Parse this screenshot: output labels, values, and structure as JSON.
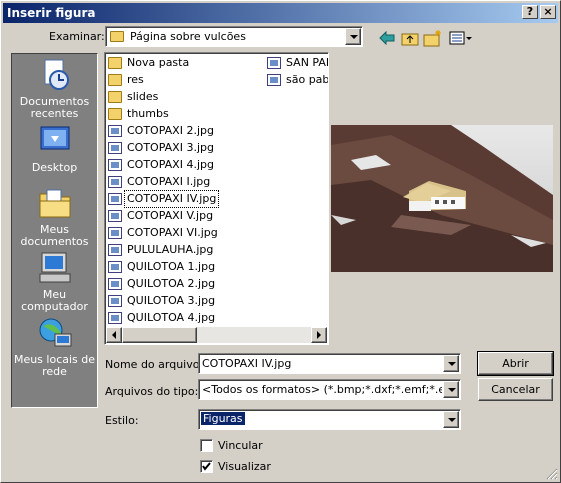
{
  "window": {
    "title": "Inserir figura",
    "help_label": "?",
    "close_label": "×"
  },
  "toolbar": {
    "examinar_label": "Examinar:",
    "folder": "Página sobre vulcões",
    "icons": [
      "back-icon",
      "up-folder-icon",
      "new-folder-icon",
      "views-icon"
    ]
  },
  "places": [
    {
      "label": "Documentos recentes",
      "icon": "recent-documents-icon"
    },
    {
      "label": "Desktop",
      "icon": "desktop-icon"
    },
    {
      "label": "Meus documentos",
      "icon": "my-documents-icon"
    },
    {
      "label": "Meu computador",
      "icon": "my-computer-icon"
    },
    {
      "label": "Meus locais de rede",
      "icon": "network-places-icon"
    }
  ],
  "files": {
    "column1": [
      {
        "name": "Nova pasta",
        "type": "folder"
      },
      {
        "name": "res",
        "type": "folder"
      },
      {
        "name": "slides",
        "type": "folder"
      },
      {
        "name": "thumbs",
        "type": "folder"
      },
      {
        "name": "COTOPAXI 2.jpg",
        "type": "image"
      },
      {
        "name": "COTOPAXI 3.jpg",
        "type": "image"
      },
      {
        "name": "COTOPAXI 4.jpg",
        "type": "image"
      },
      {
        "name": "COTOPAXI I.jpg",
        "type": "image"
      },
      {
        "name": "COTOPAXI IV.jpg",
        "type": "image",
        "selected": true
      },
      {
        "name": "COTOPAXI V.jpg",
        "type": "image"
      },
      {
        "name": "COTOPAXI VI.jpg",
        "type": "image"
      },
      {
        "name": "PULULAUHA.jpg",
        "type": "image"
      },
      {
        "name": "QUILOTOA 1.jpg",
        "type": "image"
      },
      {
        "name": "QUILOTOA 2.jpg",
        "type": "image"
      },
      {
        "name": "QUILOTOA 3.jpg",
        "type": "image"
      },
      {
        "name": "QUILOTOA 4.jpg",
        "type": "image"
      }
    ],
    "column2": [
      {
        "name": "SAN PABL",
        "type": "image"
      },
      {
        "name": "são pablc",
        "type": "image"
      }
    ]
  },
  "form": {
    "filename_label": "Nome do arquivo:",
    "filename_value": "COTOPAXI IV.jpg",
    "filetype_label": "Arquivos do tipo:",
    "filetype_value": "<Todos os formatos> (*.bmp;*.dxf;*.emf;*.eps;*.gif;*.",
    "style_label": "Estilo:",
    "style_value": "Figuras",
    "open_button": "Abrir",
    "cancel_button": "Cancelar",
    "link_label": "Vincular",
    "link_checked": false,
    "preview_label": "Visualizar",
    "preview_checked": true
  }
}
